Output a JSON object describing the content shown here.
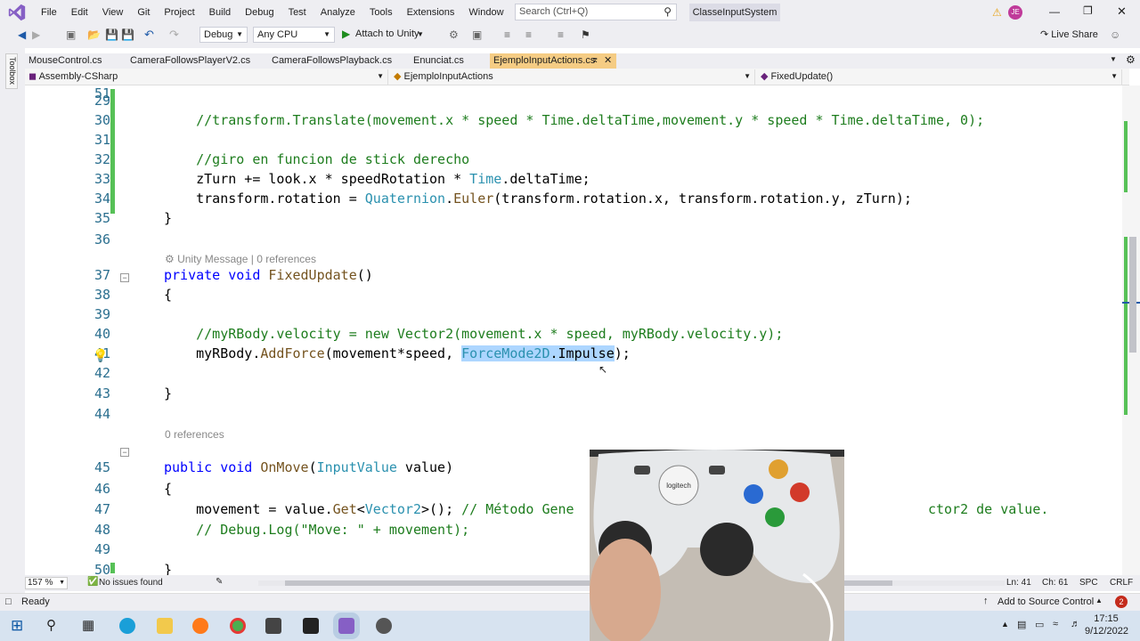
{
  "menu": [
    "File",
    "Edit",
    "View",
    "Git",
    "Project",
    "Build",
    "Debug",
    "Test",
    "Analyze",
    "Tools",
    "Extensions",
    "Window",
    "Help"
  ],
  "search": {
    "placeholder": "Search (Ctrl+Q)"
  },
  "solution_name": "ClasseInputSystem",
  "user_initials": "JE",
  "toolbar": {
    "config": "Debug",
    "platform": "Any CPU",
    "attach": "Attach to Unity",
    "live_share": "Live Share"
  },
  "sidebar": {
    "toolbox": "Toolbox"
  },
  "tabs": [
    "MouseControl.cs",
    "CameraFollowsPlayerV2.cs",
    "CameraFollowsPlayback.cs",
    "Enunciat.cs",
    "EjemploInputActions.cs"
  ],
  "nav": {
    "project": "Assembly-CSharp",
    "class": "EjemploInputActions",
    "member": "FixedUpdate()"
  },
  "lines": [
    {
      "n": "28",
      "segs": []
    },
    {
      "n": "29",
      "segs": []
    },
    {
      "n": "30",
      "segs": [
        {
          "t": "    //transform.Translate(movement.x * speed * Time.deltaTime,movement.y * speed * Time.deltaTime, 0);",
          "c": "cm"
        }
      ]
    },
    {
      "n": "31",
      "segs": []
    },
    {
      "n": "32",
      "segs": [
        {
          "t": "    //giro en funcion de stick derecho",
          "c": "cm"
        }
      ]
    },
    {
      "n": "33",
      "segs": [
        {
          "t": "    zTurn += look.x * speedRotation * ",
          "c": "pl"
        },
        {
          "t": "Time",
          "c": "ty"
        },
        {
          "t": ".deltaTime;",
          "c": "pl"
        }
      ]
    },
    {
      "n": "34",
      "segs": [
        {
          "t": "    transform.rotation = ",
          "c": "pl"
        },
        {
          "t": "Quaternion",
          "c": "ty"
        },
        {
          "t": ".",
          "c": "pl"
        },
        {
          "t": "Euler",
          "c": "mt"
        },
        {
          "t": "(transform.rotation.x, transform.rotation.y, zTurn);",
          "c": "pl"
        }
      ]
    },
    {
      "n": "35",
      "segs": [
        {
          "t": "}",
          "c": "pl"
        }
      ]
    },
    {
      "n": "36",
      "segs": []
    },
    {
      "n": "37",
      "segs": [
        {
          "t": "private",
          "c": "kw"
        },
        {
          "t": " ",
          "c": "pl"
        },
        {
          "t": "void",
          "c": "kw"
        },
        {
          "t": " ",
          "c": "pl"
        },
        {
          "t": "FixedUpdate",
          "c": "mt"
        },
        {
          "t": "()",
          "c": "pl"
        }
      ]
    },
    {
      "n": "38",
      "segs": [
        {
          "t": "{",
          "c": "pl"
        }
      ]
    },
    {
      "n": "39",
      "segs": []
    },
    {
      "n": "40",
      "segs": [
        {
          "t": "    //myRBody.velocity = new Vector2(movement.x * speed, myRBody.velocity.y);",
          "c": "cm"
        }
      ]
    },
    {
      "n": "41",
      "segs": [
        {
          "t": "    myRBody.",
          "c": "pl"
        },
        {
          "t": "AddForce",
          "c": "mt"
        },
        {
          "t": "(movement*speed, ",
          "c": "pl"
        },
        {
          "t": "ForceMode2D",
          "c": "ty hl"
        },
        {
          "t": ".Impulse",
          "c": "pl hl"
        },
        {
          "t": ");",
          "c": "pl"
        }
      ]
    },
    {
      "n": "42",
      "segs": []
    },
    {
      "n": "43",
      "segs": [
        {
          "t": "}",
          "c": "pl"
        }
      ]
    },
    {
      "n": "44",
      "segs": []
    },
    {
      "n": "45",
      "segs": [
        {
          "t": "public",
          "c": "kw"
        },
        {
          "t": " ",
          "c": "pl"
        },
        {
          "t": "void",
          "c": "kw"
        },
        {
          "t": " ",
          "c": "pl"
        },
        {
          "t": "OnMove",
          "c": "mt"
        },
        {
          "t": "(",
          "c": "pl"
        },
        {
          "t": "InputValue",
          "c": "ty"
        },
        {
          "t": " value)",
          "c": "pl"
        }
      ]
    },
    {
      "n": "46",
      "segs": [
        {
          "t": "{",
          "c": "pl"
        }
      ]
    },
    {
      "n": "47",
      "segs": [
        {
          "t": "    movement = value.",
          "c": "pl"
        },
        {
          "t": "Get",
          "c": "mt"
        },
        {
          "t": "<",
          "c": "pl"
        },
        {
          "t": "Vector2",
          "c": "ty"
        },
        {
          "t": ">(); ",
          "c": "pl"
        },
        {
          "t": "// Método Gene                                            ctor2 de value.",
          "c": "cm"
        }
      ]
    },
    {
      "n": "48",
      "segs": [
        {
          "t": "    // Debug.Log(\"Move: \" + movement);",
          "c": "cm"
        }
      ]
    },
    {
      "n": "49",
      "segs": []
    },
    {
      "n": "50",
      "segs": [
        {
          "t": "}",
          "c": "pl"
        }
      ]
    },
    {
      "n": "51",
      "segs": []
    }
  ],
  "codelens": {
    "fixedupdate": "Unity Message | 0 references",
    "onmove": "0 references"
  },
  "bottom": {
    "zoom": "157 %",
    "issues": "No issues found",
    "ln": "Ln: 41",
    "ch": "Ch: 61",
    "spc": "SPC",
    "crlf": "CRLF"
  },
  "status": {
    "ready": "Ready",
    "source_control": "Add to Source Control",
    "notif": "2"
  },
  "taskbar": {
    "time": "17:15",
    "date": "9/12/2022"
  }
}
